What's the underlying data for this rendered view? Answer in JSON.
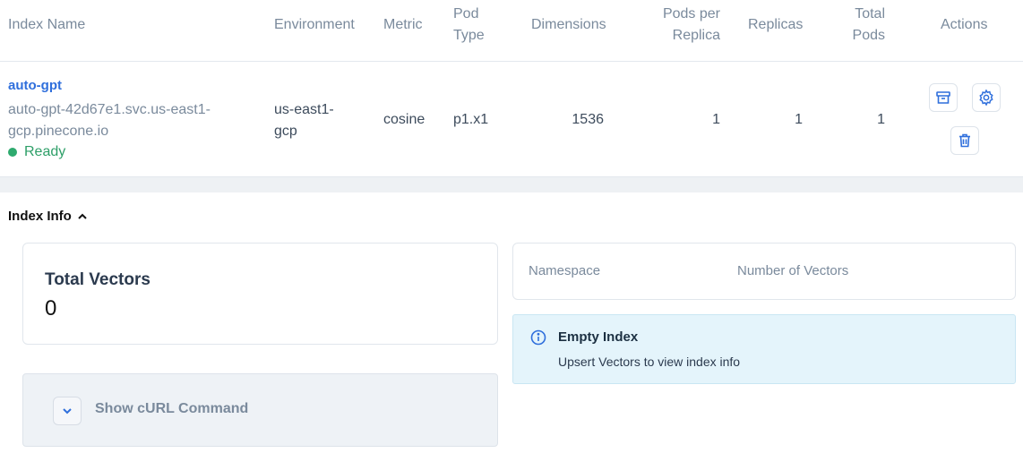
{
  "table": {
    "headers": {
      "index_name": "Index Name",
      "environment": "Environment",
      "metric": "Metric",
      "pod_type_1": "Pod",
      "pod_type_2": "Type",
      "dimensions": "Dimensions",
      "pods_per_replica_1": "Pods per",
      "pods_per_replica_2": "Replica",
      "replicas": "Replicas",
      "total_pods_1": "Total",
      "total_pods_2": "Pods",
      "actions": "Actions"
    },
    "row": {
      "name": "auto-gpt",
      "host_1": "auto-gpt-42d67e1.svc.us-east1-",
      "host_2": "gcp.pinecone.io",
      "status": "Ready",
      "environment_1": "us-east1-",
      "environment_2": "gcp",
      "metric": "cosine",
      "pod_type": "p1.x1",
      "dimensions": "1536",
      "pods_per_replica": "1",
      "replicas": "1",
      "total_pods": "1",
      "actions": [
        "archive-icon",
        "gear-icon",
        "trash-icon"
      ]
    }
  },
  "index_info": {
    "toggle_label": "Index Info",
    "total_vectors_label": "Total Vectors",
    "total_vectors_value": "0",
    "namespace_header": "Namespace",
    "num_vectors_header": "Number of Vectors",
    "alert_title": "Empty Index",
    "alert_body": "Upsert Vectors to view index info",
    "curl_label": "Show cURL Command"
  },
  "colors": {
    "accent": "#2f6fdc",
    "ready": "#2eaa6e",
    "alert_bg": "#e4f4fb"
  }
}
